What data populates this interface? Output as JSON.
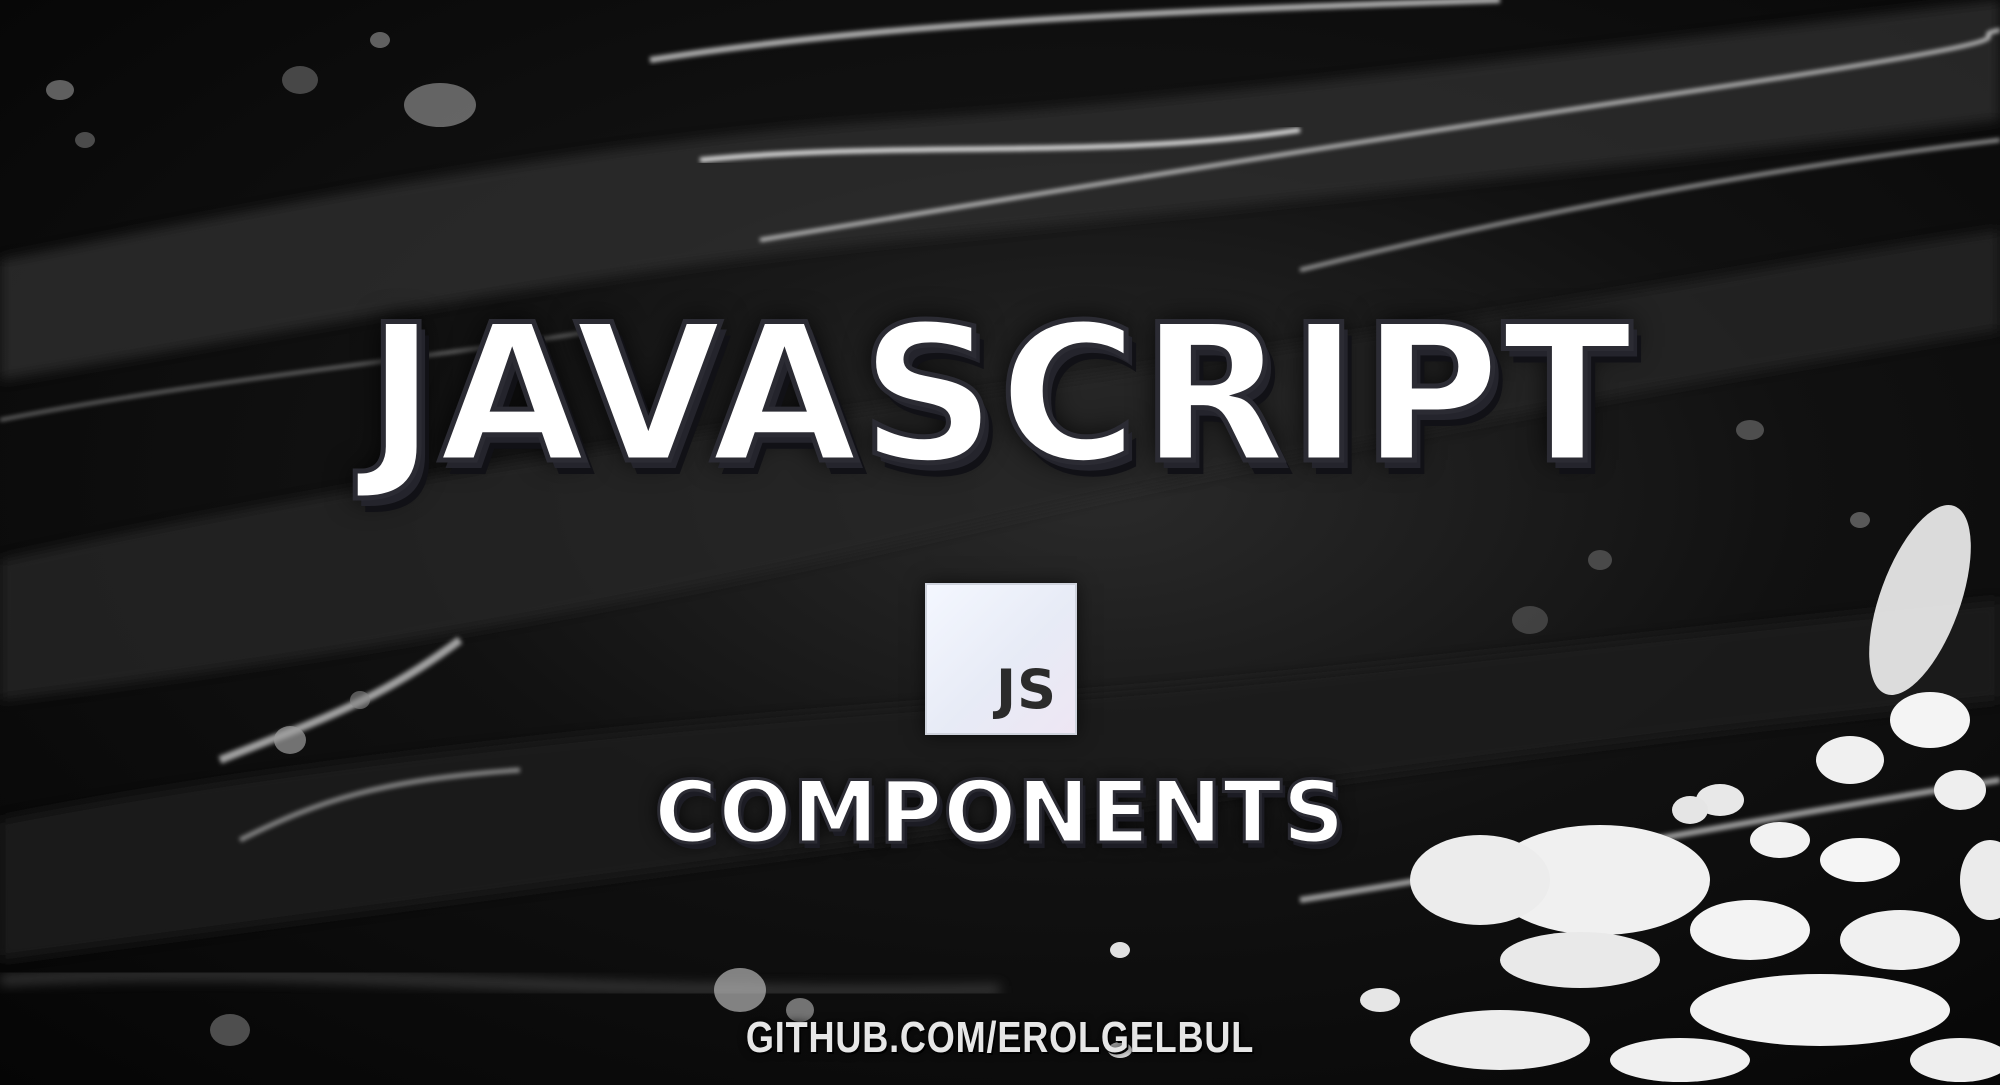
{
  "banner": {
    "title": "JAVASCRIPT",
    "logo_text": "JS",
    "subtitle": "COMPONENTS",
    "footer_link": "GITHUB.COM/EROLGELBUL"
  },
  "colors": {
    "background": "#050505",
    "text": "#ffffff",
    "outline": "#2b2b33",
    "logo_bg": "#eef1f8",
    "logo_text": "#2b2b2b"
  },
  "icons": [
    "javascript-logo-icon"
  ]
}
